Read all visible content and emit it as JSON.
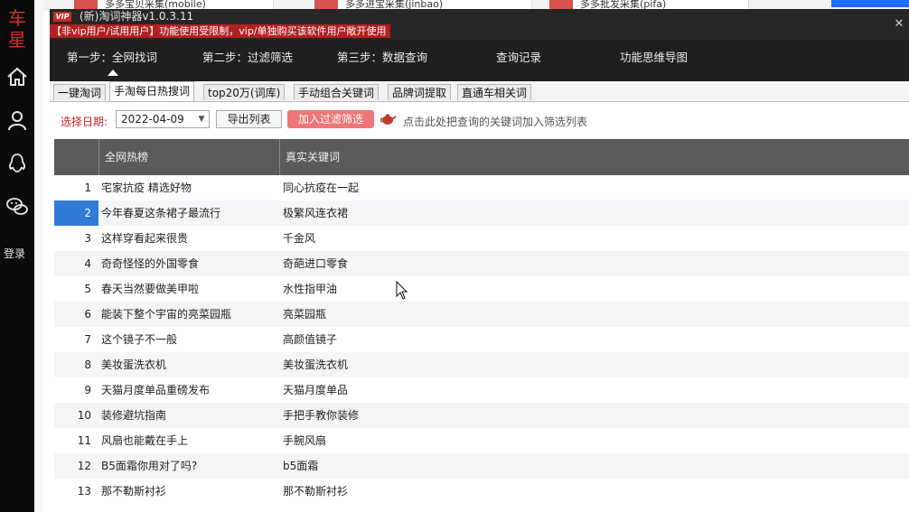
{
  "sidebar": {
    "logo": [
      "车",
      "星"
    ],
    "icons": [
      "home-icon",
      "user-icon",
      "qq-icon",
      "wechat-icon"
    ],
    "login_label": "登录"
  },
  "background_windows": [
    {
      "label": "多多宝贝采集(mobile)"
    },
    {
      "label": "多多进宝采集(jinbao)"
    },
    {
      "label": "多多批发采集(pifa)"
    }
  ],
  "window": {
    "vip_badge": "VIP",
    "title": "(新)淘词神器v1.0.3.11",
    "close_icon": "close-icon",
    "warning": "【非vip用户/试用用户】功能使用受限制，vip/单独购买该软件用户敞开使用"
  },
  "steps": [
    {
      "label": "第一步：全网找词",
      "active": true
    },
    {
      "label": "第二步：过滤筛选",
      "active": false
    },
    {
      "label": "第三步：数据查询",
      "active": false
    },
    {
      "label": "查询记录",
      "active": false
    },
    {
      "label": "功能思维导图",
      "active": false
    }
  ],
  "tabs": [
    {
      "label": "一键淘词",
      "active": false
    },
    {
      "label": "手淘每日热搜词",
      "active": true
    },
    {
      "label": "top20万(词库)",
      "active": false
    },
    {
      "label": "手动组合关键词",
      "active": false
    },
    {
      "label": "品牌词提取",
      "active": false
    },
    {
      "label": "直通车相关词",
      "active": false
    }
  ],
  "toolbar": {
    "date_label": "选择日期:",
    "date_value": "2022-04-09",
    "export_button": "导出列表",
    "add_filter_button": "加入过滤筛选",
    "hint_text": "点击此处把查询的关键词加入筛选列表",
    "accent_color": "#cc2222"
  },
  "grid": {
    "columns": [
      "全网热榜",
      "真实关键词"
    ],
    "selected_row": 2,
    "rows": [
      {
        "num": "1",
        "hot": "宅家抗疫 精选好物",
        "keyword": "同心抗疫在一起"
      },
      {
        "num": "2",
        "hot": "今年春夏这条裙子最流行",
        "keyword": "极繁风连衣裙"
      },
      {
        "num": "3",
        "hot": "这样穿看起来很贵",
        "keyword": "千金风"
      },
      {
        "num": "4",
        "hot": "奇奇怪怪的外国零食",
        "keyword": "奇葩进口零食"
      },
      {
        "num": "5",
        "hot": "春天当然要做美甲啦",
        "keyword": "水性指甲油"
      },
      {
        "num": "6",
        "hot": "能装下整个宇宙的亮菜园瓶",
        "keyword": "亮菜园瓶"
      },
      {
        "num": "7",
        "hot": "这个镜子不一般",
        "keyword": "高颜值镜子"
      },
      {
        "num": "8",
        "hot": "美妆蛋洗衣机",
        "keyword": "美妆蛋洗衣机"
      },
      {
        "num": "9",
        "hot": "天猫月度单品重磅发布",
        "keyword": "天猫月度单品"
      },
      {
        "num": "10",
        "hot": "装修避坑指南",
        "keyword": "手把手教你装修"
      },
      {
        "num": "11",
        "hot": "风扇也能戴在手上",
        "keyword": "手腕风扇"
      },
      {
        "num": "12",
        "hot": "B5面霜你用对了吗?",
        "keyword": "b5面霜"
      },
      {
        "num": "13",
        "hot": "那不勒斯衬衫",
        "keyword": "那不勒斯衬衫"
      }
    ]
  }
}
